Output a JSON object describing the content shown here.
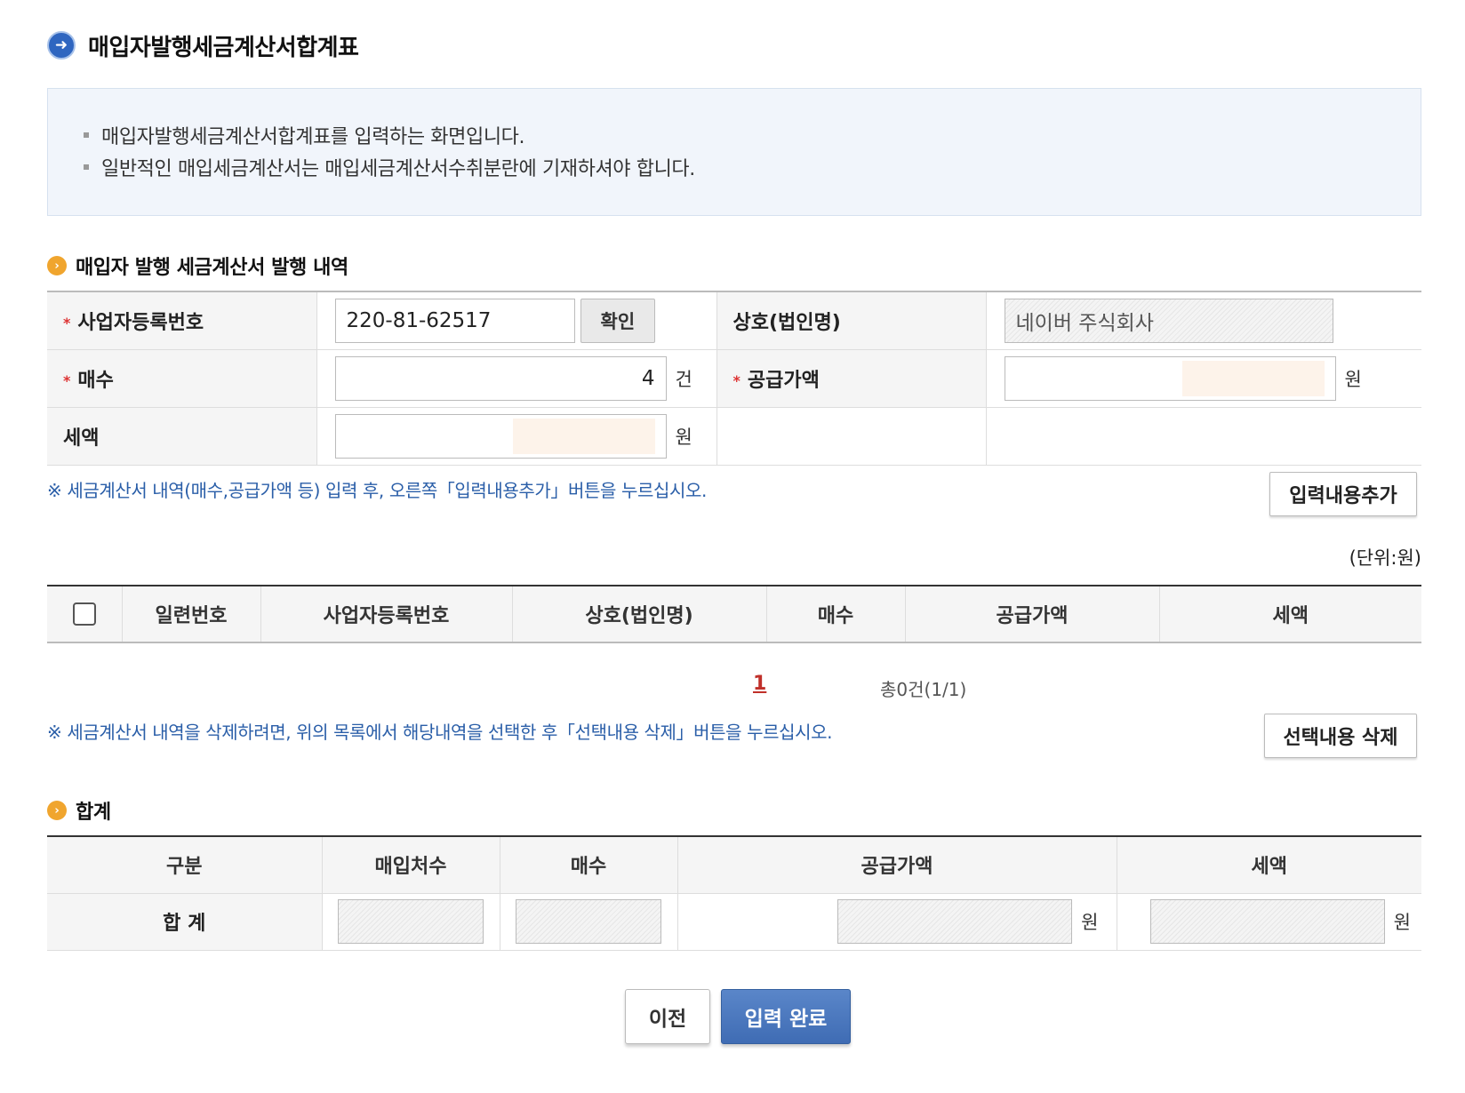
{
  "page": {
    "title": "매입자발행세금계산서합계표"
  },
  "info": {
    "items": [
      "매입자발행세금계산서합계표를 입력하는 화면입니다.",
      "일반적인 매입세금계산서는 매입세금계산서수취분란에 기재하셔야 합니다."
    ]
  },
  "issue_section": {
    "title": "매입자 발행 세금계산서 발행 내역",
    "biz_no_label": "사업자등록번호",
    "biz_no_value": "220-81-62517",
    "confirm_button": "확인",
    "company_label": "상호(법인명)",
    "company_value": "네이버 주식회사",
    "count_label": "매수",
    "count_value": "4",
    "count_unit": "건",
    "supply_label": "공급가액",
    "supply_unit": "원",
    "tax_label": "세액",
    "tax_unit": "원",
    "note": "※ 세금계산서 내역(매수,공급가액 등) 입력 후, 오른쪽「입력내용추가」버튼을 누르십시오.",
    "add_button": "입력내용추가"
  },
  "list": {
    "unit_note": "(단위:원)",
    "headers": [
      "일련번호",
      "사업자등록번호",
      "상호(법인명)",
      "매수",
      "공급가액",
      "세액"
    ],
    "page": "1",
    "total": "총0건(1/1)",
    "delete_note": "※ 세금계산서 내역을 삭제하려면, 위의 목록에서 해당내역을 선택한 후「선택내용 삭제」버튼을 누르십시오.",
    "delete_button": "선택내용 삭제"
  },
  "summary": {
    "title": "합계",
    "headers": [
      "구분",
      "매입처수",
      "매수",
      "공급가액",
      "세액"
    ],
    "row_label": "합 계",
    "supply_unit": "원",
    "tax_unit": "원"
  },
  "footer": {
    "prev_button": "이전",
    "done_button": "입력 완료"
  },
  "colors": {
    "accent_blue": "#3f6cb4",
    "note_blue": "#2a5ea8",
    "required_red": "#dd3333",
    "section_orange": "#f0a52e"
  }
}
